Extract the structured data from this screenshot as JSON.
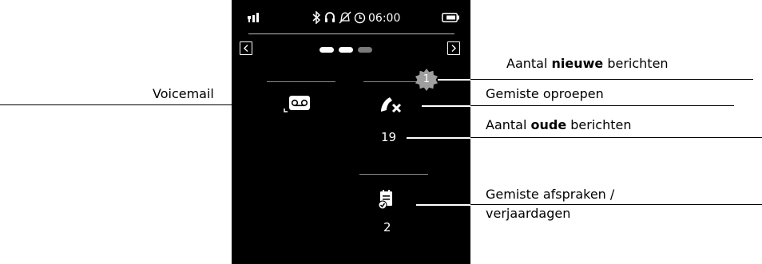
{
  "status_bar": {
    "time": "06:00",
    "icons": [
      "signal-icon",
      "bluetooth-icon",
      "headset-icon",
      "ringer-off-icon",
      "alarm-icon",
      "battery-icon"
    ]
  },
  "pager": {
    "icons": [
      "chevron-left-icon",
      "chevron-right-icon"
    ],
    "pages_total": 3,
    "active_pages": [
      1,
      2
    ]
  },
  "tiles": {
    "voicemail": {
      "icon": "voicemail-icon"
    },
    "missed_calls": {
      "icon": "missed-call-icon",
      "new_count": "1",
      "old_count": "19"
    },
    "appointments": {
      "icon": "calendar-check-icon",
      "count": "2"
    }
  },
  "callouts": {
    "voicemail": "Voicemail",
    "new_messages": {
      "pre": "Aantal ",
      "bold": "nieuwe",
      "post": " berichten"
    },
    "missed_calls": "Gemiste oproepen",
    "old_messages": {
      "pre": "Aantal ",
      "bold": "oude",
      "post": " berichten"
    },
    "appointments_line1": "Gemiste afspraken /",
    "appointments_line2": "verjaardagen"
  },
  "colors": {
    "screen_bg": "#000000",
    "badge": "#9e9e9e",
    "page_dot_active": "#ffffff",
    "page_dot_inactive": "#7a7a7a"
  }
}
